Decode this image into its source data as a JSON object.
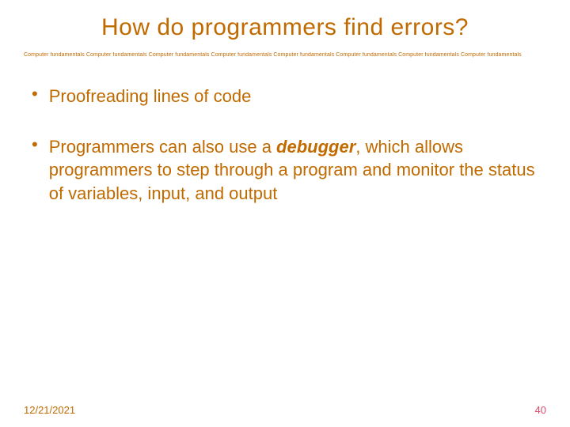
{
  "title": "How do programmers find errors?",
  "divider": "Computer fundamentals Computer fundamentals Computer fundamentals Computer fundamentals Computer fundamentals Computer fundamentals Computer fundamentals Computer fundamentals",
  "bullets": {
    "b1": "Proofreading lines of code",
    "b2_pre": "Programmers can also use a ",
    "b2_term": "debugger",
    "b2_post": ", which allows programmers to step through a program and monitor the status of variables, input, and output"
  },
  "footer": {
    "date": "12/21/2021",
    "page": "40"
  },
  "colors": {
    "accent": "#c06a00",
    "page_number": "#d94a6b"
  }
}
